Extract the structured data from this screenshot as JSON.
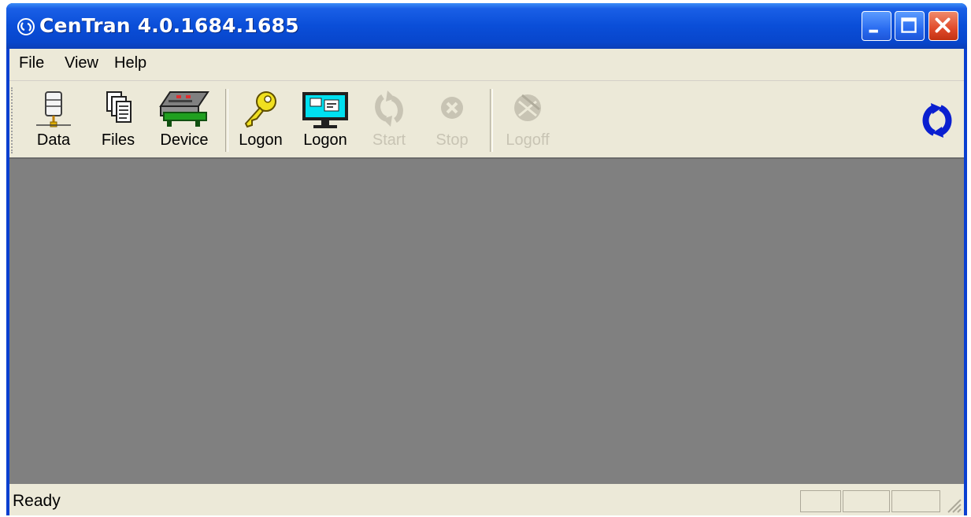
{
  "window": {
    "title": "CenTran 4.0.1684.1685",
    "title_bar_color": "#0a4ed8",
    "close_button_color": "#e04a2a"
  },
  "menu": {
    "items": [
      {
        "label": "File"
      },
      {
        "label": "View"
      },
      {
        "label": "Help"
      }
    ]
  },
  "toolbar": {
    "buttons": [
      {
        "label": "Data",
        "icon": "database-server-icon",
        "enabled": true
      },
      {
        "label": "Files",
        "icon": "files-icon",
        "enabled": true
      },
      {
        "label": "Device",
        "icon": "device-icon",
        "enabled": true
      },
      {
        "label": "Logon",
        "icon": "key-icon",
        "enabled": true
      },
      {
        "label": "Logon",
        "icon": "monitor-icon",
        "enabled": true
      },
      {
        "label": "Start",
        "icon": "sync-arrows-icon",
        "enabled": false
      },
      {
        "label": "Stop",
        "icon": "stop-circle-icon",
        "enabled": false
      },
      {
        "label": "Logoff",
        "icon": "logoff-icon",
        "enabled": false
      }
    ],
    "brand_icon": "centran-logo-icon",
    "brand_color": "#0a1fd0"
  },
  "workspace": {
    "background_color": "#808080"
  },
  "status": {
    "text": "Ready"
  }
}
